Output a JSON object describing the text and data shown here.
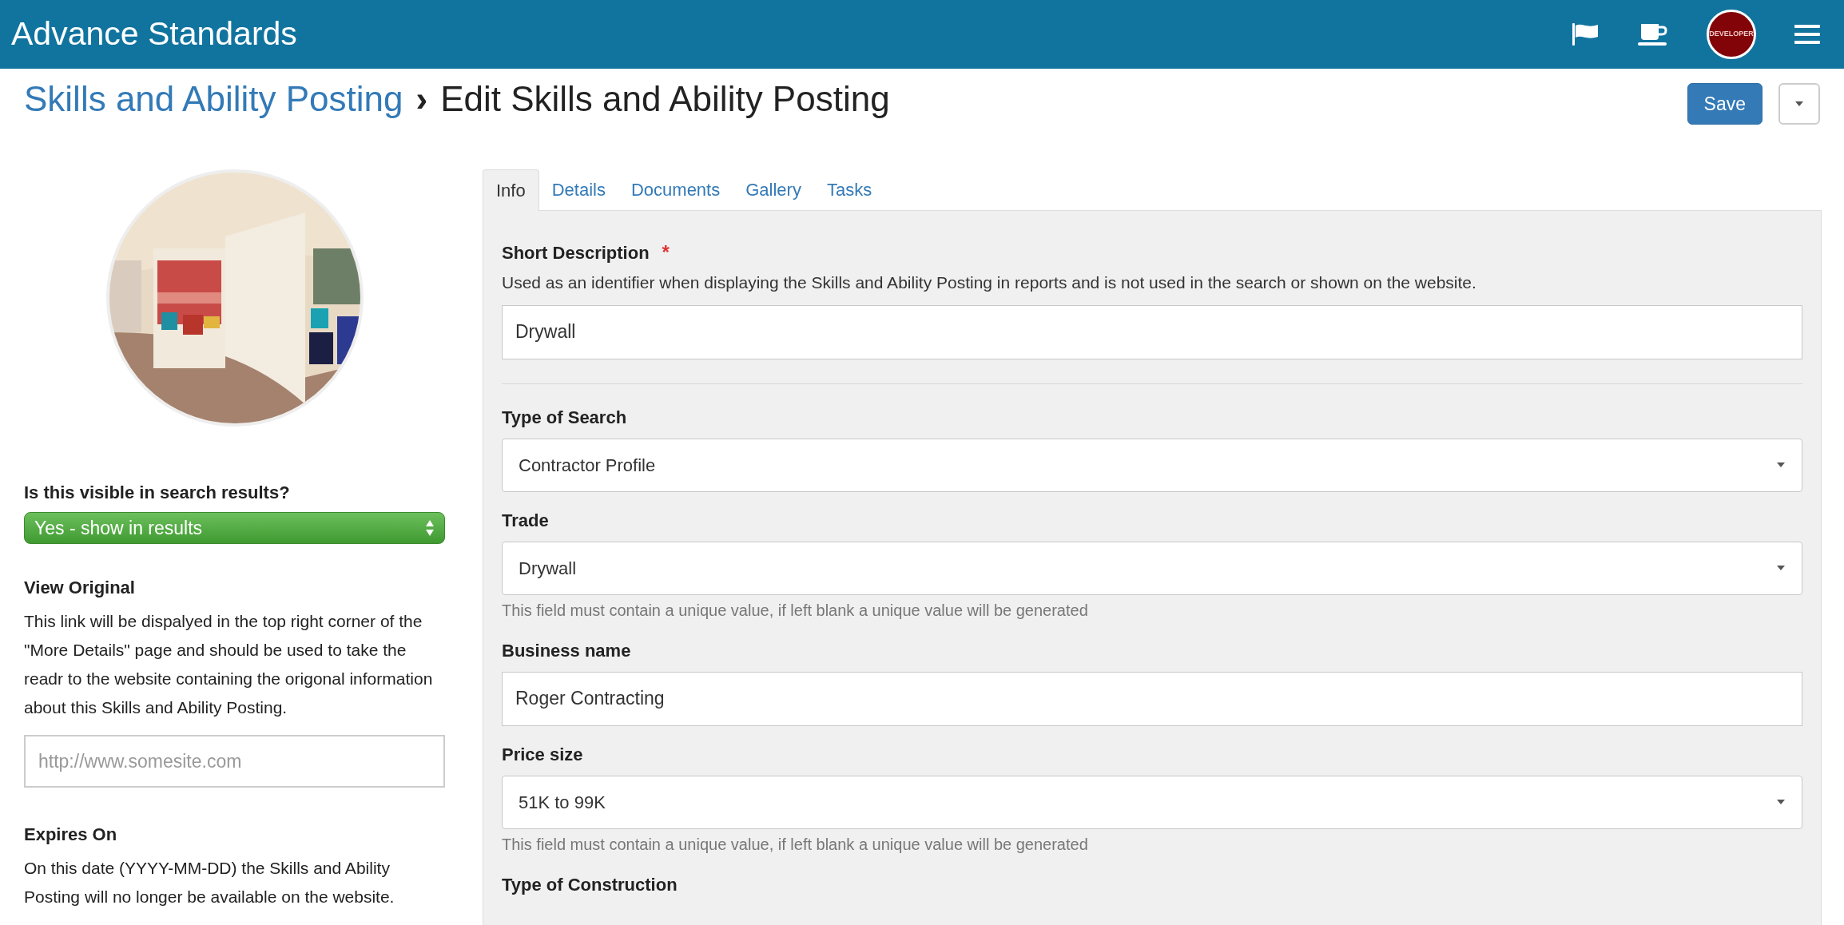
{
  "app_bar": {
    "title": "Advance Standards",
    "avatar_label": "DEVELOPER"
  },
  "breadcrumb": {
    "parent": "Skills and Ability Posting",
    "separator": "›",
    "current": "Edit Skills and Ability Posting"
  },
  "actions": {
    "save": "Save"
  },
  "sidebar": {
    "visibility": {
      "label": "Is this visible in search results?",
      "value": "Yes - show in results"
    },
    "view_original": {
      "label": "View Original",
      "help": "This link will be dispalyed in the top right corner of the \"More Details\" page and should be used to take the readr to the website containing the origonal information about this Skills and Ability Posting.",
      "placeholder": "http://www.somesite.com"
    },
    "expires_on": {
      "label": "Expires On",
      "help": "On this date (YYYY-MM-DD) the Skills and Ability Posting will no longer be available on the website."
    }
  },
  "tabs": [
    {
      "label": "Info",
      "selected": true
    },
    {
      "label": "Details",
      "selected": false
    },
    {
      "label": "Documents",
      "selected": false
    },
    {
      "label": "Gallery",
      "selected": false
    },
    {
      "label": "Tasks",
      "selected": false
    }
  ],
  "form": {
    "sections": [
      [
        {
          "kind": "text",
          "label": "Short Description",
          "required_mark": "*",
          "help": "Used as an identifier when displaying the Skills and Ability Posting in reports and is not used in the search or shown on the website.",
          "value": "Drywall"
        }
      ],
      [
        {
          "kind": "select",
          "label": "Type of Search",
          "value": "Contractor Profile"
        },
        {
          "kind": "select",
          "label": "Trade",
          "value": "Drywall",
          "note": "This field must contain a unique value, if left blank a unique value will be generated"
        },
        {
          "kind": "text",
          "label": "Business name",
          "value": "Roger Contracting"
        },
        {
          "kind": "select",
          "label": "Price size",
          "value": "51K to 99K",
          "note": "This field must contain a unique value, if left blank a unique value will be generated"
        },
        {
          "kind": "label",
          "label": "Type of Construction"
        }
      ]
    ]
  }
}
